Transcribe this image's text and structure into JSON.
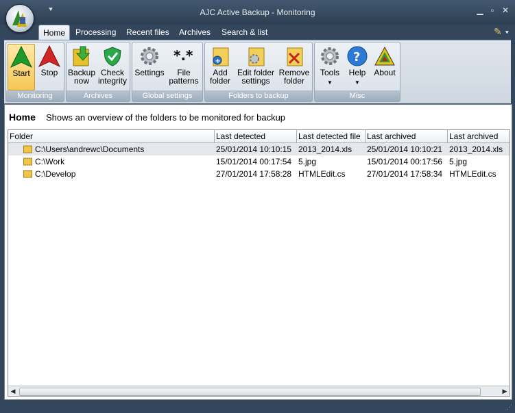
{
  "window": {
    "title": "AJC Active Backup - Monitoring"
  },
  "tabs": [
    {
      "label": "Home",
      "active": true
    },
    {
      "label": "Processing"
    },
    {
      "label": "Recent files"
    },
    {
      "label": "Archives"
    },
    {
      "label": "Search & list"
    }
  ],
  "ribbon": {
    "groups": {
      "monitoring": "Monitoring",
      "archives": "Archives",
      "global": "Global settings",
      "folders": "Folders to backup",
      "misc": "Misc"
    },
    "buttons": {
      "start": "Start",
      "stop": "Stop",
      "backup_now_1": "Backup",
      "backup_now_2": "now",
      "check_integrity_1": "Check",
      "check_integrity_2": "integrity",
      "settings": "Settings",
      "file_patterns_1": "File",
      "file_patterns_2": "patterns",
      "add_folder_1": "Add",
      "add_folder_2": "folder",
      "edit_folder_1": "Edit folder",
      "edit_folder_2": "settings",
      "remove_folder_1": "Remove",
      "remove_folder_2": "folder",
      "tools": "Tools",
      "help": "Help",
      "about": "About"
    }
  },
  "page": {
    "title": "Home",
    "description": "Shows an overview of the folders to be monitored for backup"
  },
  "table": {
    "columns": [
      "Folder",
      "Last detected",
      "Last detected file",
      "Last archived",
      "Last archived file"
    ],
    "rows": [
      [
        "C:\\Users\\andrewc\\Documents",
        "25/01/2014 10:10:15",
        "2013_2014.xls",
        "25/01/2014 10:10:21",
        "2013_2014.xls"
      ],
      [
        "C:\\Work",
        "15/01/2014 00:17:54",
        "5.jpg",
        "15/01/2014 00:17:56",
        "5.jpg"
      ],
      [
        "C:\\Develop",
        "27/01/2014 17:58:28",
        "HTMLEdit.cs",
        "27/01/2014 17:58:34",
        "HTMLEdit.cs"
      ]
    ]
  },
  "colors": {
    "accent": "#34465c",
    "selection": "#e4e8ed"
  }
}
